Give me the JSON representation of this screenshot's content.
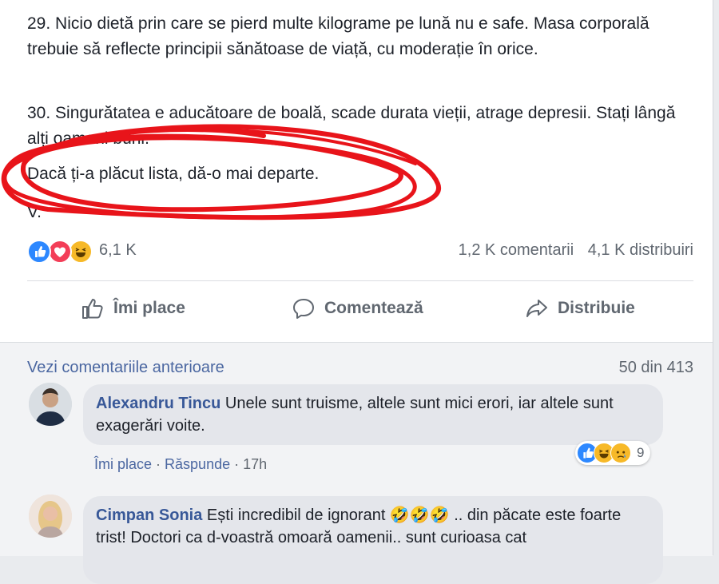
{
  "post": {
    "item29": "29. Nicio dietă prin care se pierd multe kilograme pe lună nu e safe. Masa corporală trebuie să reflecte principii sănătoase de viață, cu moderație în orice.",
    "item30": "30. Singurătatea e aducătoare de boală, scade durata vieții, atrage depresii. Stați lângă alți oameni buni.",
    "cta": "Dacă ți-a plăcut lista, dă-o mai departe.",
    "signature": "V."
  },
  "reactions": {
    "icons": [
      "like-icon",
      "love-icon",
      "haha-icon"
    ],
    "count": "6,1 K",
    "comments": "1,2 K comentarii",
    "shares": "4,1 K distribuiri"
  },
  "actions": {
    "like": "Îmi place",
    "comment": "Comentează",
    "share": "Distribuie"
  },
  "comments_section": {
    "view_previous": "Vezi comentariile anterioare",
    "count": "50 din 413",
    "comments": [
      {
        "author": "Alexandru Tincu",
        "text": "Unele sunt truisme, altele sunt mici erori, iar altele sunt exagerări voite.",
        "like": "Îmi place",
        "reply": "Răspunde",
        "time": "17h",
        "reactions": [
          "like-icon",
          "haha-icon",
          "sad-icon"
        ],
        "reaction_count": "9"
      },
      {
        "author": "Cimpan Sonia",
        "text": "Ești incredibil de ignorant 🤣🤣🤣 .. din păcate este foarte trist! Doctori ca d-voastră omoară oamenii.. sunt curioasa cat"
      }
    ]
  },
  "colors": {
    "annotation": "#e8141a",
    "link": "#385898",
    "like_blue": "#2d88ff",
    "love_red": "#f33e58",
    "haha_yellow": "#f7b928"
  }
}
